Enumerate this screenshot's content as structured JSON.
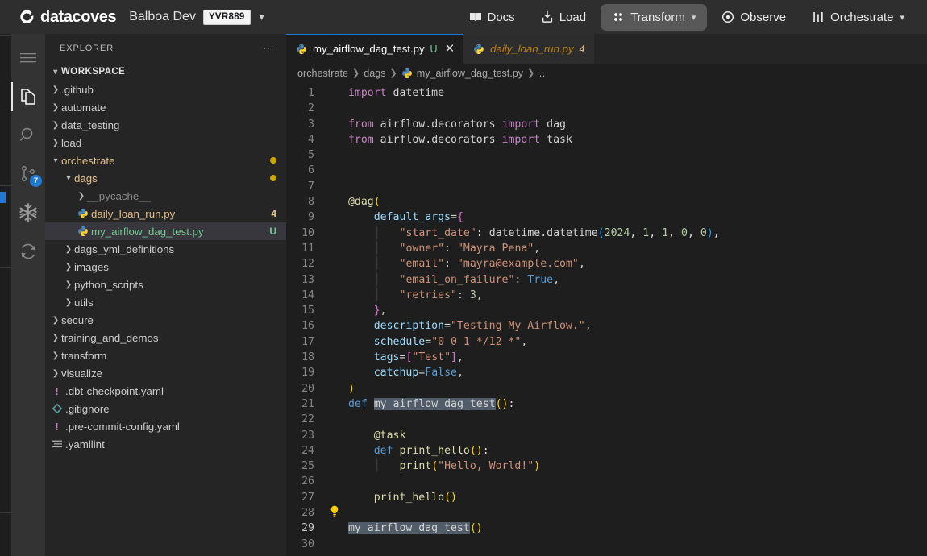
{
  "header": {
    "brand": "datacoves",
    "brand_logo_icon": "datacoves-logo-icon",
    "environment": "Balboa Dev",
    "env_badge": "YVR889",
    "env_caret_icon": "chevron-down-icon",
    "nav": [
      {
        "label": "Docs",
        "icon": "book-icon",
        "active": false,
        "caret": false
      },
      {
        "label": "Load",
        "icon": "download-icon",
        "active": false,
        "caret": false
      },
      {
        "label": "Transform",
        "icon": "grid-dots-icon",
        "active": true,
        "caret": true
      },
      {
        "label": "Observe",
        "icon": "eye-target-icon",
        "active": false,
        "caret": false
      },
      {
        "label": "Orchestrate",
        "icon": "sliders-icon",
        "active": false,
        "caret": true
      }
    ]
  },
  "activity_bar": {
    "items": [
      {
        "name": "menu-icon",
        "icon": "hamburger-icon",
        "selected": false,
        "badge": ""
      },
      {
        "name": "explorer-icon",
        "icon": "files-icon",
        "selected": true,
        "badge": ""
      },
      {
        "name": "search-icon",
        "icon": "magnifier-icon",
        "selected": false,
        "badge": ""
      },
      {
        "name": "source-control-icon",
        "icon": "git-branch-icon",
        "selected": false,
        "badge": "7"
      },
      {
        "name": "snowflake-icon",
        "icon": "snowflake-icon",
        "selected": false,
        "badge": ""
      },
      {
        "name": "sync-icon",
        "icon": "refresh-icon",
        "selected": false,
        "badge": ""
      }
    ]
  },
  "sidebar": {
    "title": "EXPLORER",
    "more_actions_icon": "ellipsis-icon",
    "section": {
      "label": "WORKSPACE",
      "expanded": true
    },
    "items": [
      {
        "label": ".github",
        "indent": 1,
        "type": "folder",
        "expanded": false,
        "mark": "",
        "mark_kind": "",
        "modified": false
      },
      {
        "label": "automate",
        "indent": 1,
        "type": "folder",
        "expanded": false,
        "mark": "",
        "mark_kind": "",
        "modified": false
      },
      {
        "label": "data_testing",
        "indent": 1,
        "type": "folder",
        "expanded": false,
        "mark": "",
        "mark_kind": "",
        "modified": false
      },
      {
        "label": "load",
        "indent": 1,
        "type": "folder",
        "expanded": false,
        "mark": "",
        "mark_kind": "",
        "modified": false
      },
      {
        "label": "orchestrate",
        "indent": 1,
        "type": "folder",
        "expanded": true,
        "mark": "",
        "mark_kind": "mod",
        "modified": true
      },
      {
        "label": "dags",
        "indent": 2,
        "type": "folder",
        "expanded": true,
        "mark": "",
        "mark_kind": "mod",
        "modified": true
      },
      {
        "label": "__pycache__",
        "indent": 3,
        "type": "folder",
        "expanded": false,
        "mark": "",
        "mark_kind": "dim",
        "modified": false
      },
      {
        "label": "daily_loan_run.py",
        "indent": 3,
        "type": "python",
        "expanded": null,
        "mark": "4",
        "mark_kind": "mod",
        "modified": false
      },
      {
        "label": "my_airflow_dag_test.py",
        "indent": 3,
        "type": "python",
        "expanded": null,
        "mark": "U",
        "mark_kind": "new",
        "modified": false,
        "selected": true
      },
      {
        "label": "dags_yml_definitions",
        "indent": 2,
        "type": "folder",
        "expanded": false,
        "mark": "",
        "mark_kind": "",
        "modified": false
      },
      {
        "label": "images",
        "indent": 2,
        "type": "folder",
        "expanded": false,
        "mark": "",
        "mark_kind": "",
        "modified": false
      },
      {
        "label": "python_scripts",
        "indent": 2,
        "type": "folder",
        "expanded": false,
        "mark": "",
        "mark_kind": "",
        "modified": false
      },
      {
        "label": "utils",
        "indent": 2,
        "type": "folder",
        "expanded": false,
        "mark": "",
        "mark_kind": "",
        "modified": false
      },
      {
        "label": "secure",
        "indent": 1,
        "type": "folder",
        "expanded": false,
        "mark": "",
        "mark_kind": "",
        "modified": false
      },
      {
        "label": "training_and_demos",
        "indent": 1,
        "type": "folder",
        "expanded": false,
        "mark": "",
        "mark_kind": "",
        "modified": false
      },
      {
        "label": "transform",
        "indent": 1,
        "type": "folder",
        "expanded": false,
        "mark": "",
        "mark_kind": "",
        "modified": false
      },
      {
        "label": "visualize",
        "indent": 1,
        "type": "folder",
        "expanded": false,
        "mark": "",
        "mark_kind": "",
        "modified": false
      },
      {
        "label": ".dbt-checkpoint.yaml",
        "indent": 1,
        "type": "yaml",
        "expanded": null,
        "mark": "",
        "mark_kind": "",
        "modified": false
      },
      {
        "label": ".gitignore",
        "indent": 1,
        "type": "git",
        "expanded": null,
        "mark": "",
        "mark_kind": "",
        "modified": false
      },
      {
        "label": ".pre-commit-config.yaml",
        "indent": 1,
        "type": "yaml",
        "expanded": null,
        "mark": "",
        "mark_kind": "",
        "modified": false
      },
      {
        "label": ".yamllint",
        "indent": 1,
        "type": "lint",
        "expanded": null,
        "mark": "",
        "mark_kind": "",
        "modified": false
      }
    ]
  },
  "editor": {
    "tabs": [
      {
        "label": "my_airflow_dag_test.py",
        "icon": "python-icon",
        "mark": "U",
        "active": true,
        "closeable": true,
        "close_icon": "close-icon"
      },
      {
        "label": "daily_loan_run.py",
        "icon": "python-icon",
        "mark": "4",
        "active": false,
        "closeable": false,
        "close_icon": ""
      }
    ],
    "breadcrumb": [
      "orchestrate",
      "dags",
      "my_airflow_dag_test.py",
      "…"
    ],
    "breadcrumb_file_icon": "python-icon",
    "line_numbers": [
      1,
      2,
      3,
      4,
      5,
      6,
      7,
      8,
      9,
      10,
      11,
      12,
      13,
      14,
      15,
      16,
      17,
      18,
      19,
      20,
      21,
      22,
      23,
      24,
      25,
      26,
      27,
      28,
      29,
      30
    ],
    "current_line": 29,
    "lightbulb": {
      "line": 28,
      "icon": "lightbulb-icon"
    },
    "source_text": [
      "import datetime",
      "",
      "from airflow.decorators import dag",
      "from airflow.decorators import task",
      "",
      "",
      "",
      "@dag(",
      "    default_args={",
      "        \"start_date\": datetime.datetime(2024, 1, 1, 0, 0),",
      "        \"owner\": \"Mayra Pena\",",
      "        \"email\": \"mayra@example.com\",",
      "        \"email_on_failure\": True,",
      "        \"retries\": 3,",
      "    },",
      "    description=\"Testing My Airflow.\",",
      "    schedule=\"0 0 1 */12 *\",",
      "    tags=[\"Test\"],",
      "    catchup=False,",
      ")",
      "def my_airflow_dag_test():",
      "",
      "    @task",
      "    def print_hello():",
      "        print(\"Hello, World!\")",
      "",
      "    print_hello()",
      "",
      "my_airflow_dag_test()",
      ""
    ]
  },
  "colors": {
    "accent_blue": "#1f7ad4",
    "modified_yellow": "#cca700",
    "untracked_green": "#73c991",
    "modified_file": "#e2c08d",
    "editor_bg": "#1e1e1e",
    "sidebar_bg": "#252526",
    "activity_bg": "#333333",
    "topbar_bg": "#2e2e2e"
  }
}
